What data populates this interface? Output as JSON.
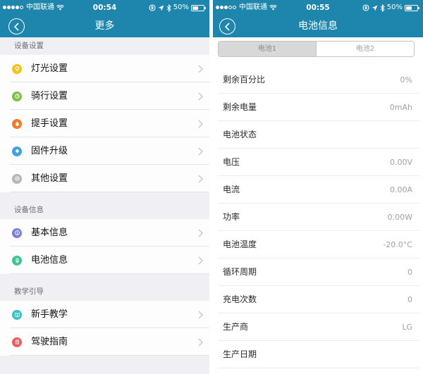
{
  "colors": {
    "header_bg": "#1e86ad",
    "list_bg": "#efeff4"
  },
  "more": {
    "status": {
      "signal_bars": 4,
      "signal_max": 5,
      "carrier": "中国联通",
      "time": "00:54",
      "battery_text": "50%",
      "battery_level": 50
    },
    "nav": {
      "title": "更多"
    },
    "sections": [
      {
        "header": "设备设置",
        "items": [
          {
            "label": "灯光设置",
            "icon": "bulb-icon",
            "color": "#f5c417"
          },
          {
            "label": "骑行设置",
            "icon": "cycling-icon",
            "color": "#7dc144"
          },
          {
            "label": "提手设置",
            "icon": "handle-icon",
            "color": "#f47b2b"
          },
          {
            "label": "固件升级",
            "icon": "firmware-upgrade-icon",
            "color": "#3da3e6"
          },
          {
            "label": "其他设置",
            "icon": "other-settings-icon",
            "color": "#b7b7b7"
          }
        ]
      },
      {
        "header": "设备信息",
        "items": [
          {
            "label": "基本信息",
            "icon": "info-icon",
            "color": "#7b7fd8"
          },
          {
            "label": "电池信息",
            "icon": "battery-icon",
            "color": "#3ec58b"
          }
        ]
      },
      {
        "header": "教学引导",
        "items": [
          {
            "label": "新手教学",
            "icon": "book-icon",
            "color": "#3fbec4"
          },
          {
            "label": "驾驶指南",
            "icon": "guide-icon",
            "color": "#ef5d5d"
          }
        ]
      }
    ]
  },
  "battery_info": {
    "status": {
      "signal_bars": 3,
      "signal_max": 5,
      "carrier": "中国联通",
      "time": "00:55",
      "battery_text": "50%",
      "battery_level": 50
    },
    "nav": {
      "title": "电池信息"
    },
    "tabs": [
      {
        "label": "电池1",
        "selected": true
      },
      {
        "label": "电池2",
        "selected": false
      }
    ],
    "rows": [
      {
        "label": "剩余百分比",
        "value": "0%"
      },
      {
        "label": "剩余电量",
        "value": "0mAh"
      },
      {
        "label": "电池状态",
        "value": ""
      },
      {
        "label": "电压",
        "value": "0.00V"
      },
      {
        "label": "电流",
        "value": "0.00A"
      },
      {
        "label": "功率",
        "value": "0.00W"
      },
      {
        "label": "电池温度",
        "value": "-20.0°C"
      },
      {
        "label": "循环周期",
        "value": "0"
      },
      {
        "label": "充电次数",
        "value": "0"
      },
      {
        "label": "生产商",
        "value": "LG"
      },
      {
        "label": "生产日期",
        "value": ""
      }
    ]
  }
}
